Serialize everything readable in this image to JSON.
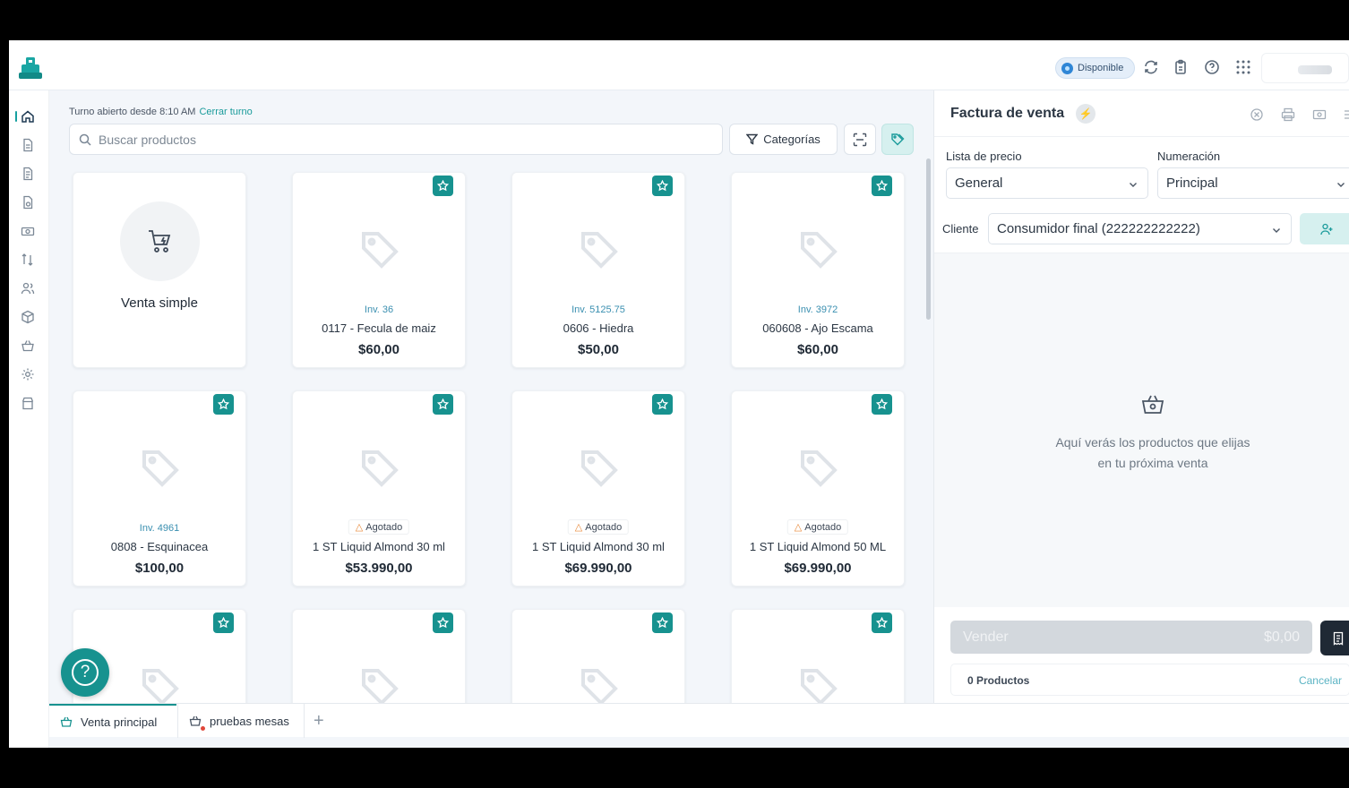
{
  "topbar": {
    "status_label": "Disponible"
  },
  "main": {
    "shift_text": "Turno abierto desde 8:10 AM",
    "shift_link": "Cerrar turno",
    "search_placeholder": "Buscar productos",
    "categories_label": "Categorías"
  },
  "products": {
    "simple_label": "Venta simple",
    "items": [
      {
        "inv": "Inv. 36",
        "status": "",
        "name": "0117 - Fecula de maiz",
        "price": "$60,00"
      },
      {
        "inv": "Inv. 5125.75",
        "status": "",
        "name": "0606 - Hiedra",
        "price": "$50,00"
      },
      {
        "inv": "Inv. 3972",
        "status": "",
        "name": "060608 - Ajo Escama",
        "price": "$60,00"
      },
      {
        "inv": "Inv. 4961",
        "status": "",
        "name": "0808 - Esquinacea",
        "price": "$100,00"
      },
      {
        "inv": "",
        "status": "Agotado",
        "name": "1 ST Liquid Almond 30 ml",
        "price": "$53.990,00"
      },
      {
        "inv": "",
        "status": "Agotado",
        "name": "1 ST Liquid Almond 30 ml",
        "price": "$69.990,00"
      },
      {
        "inv": "",
        "status": "Agotado",
        "name": "1 ST Liquid Almond 50 ML",
        "price": "$69.990,00"
      }
    ]
  },
  "tabs": [
    {
      "label": "Venta principal"
    },
    {
      "label": "pruebas mesas"
    }
  ],
  "tab_add_label": "+",
  "panel": {
    "title": "Factura de venta",
    "price_list_label": "Lista de precio",
    "price_list_value": "General",
    "numbering_label": "Numeración",
    "numbering_value": "Principal",
    "client_label": "Cliente",
    "client_value": "Consumidor final (222222222222)",
    "empty_line1": "Aquí verás los productos que elijas",
    "empty_line2": "en tu próxima venta",
    "sell_label": "Vender",
    "sell_total": "$0,00",
    "products_count": "0 Productos",
    "cancel_label": "Cancelar"
  },
  "colors": {
    "accent": "#17928f",
    "accent_light": "#d6f0ef",
    "status_blue": "#2f86d6",
    "warning": "#e8893a"
  }
}
